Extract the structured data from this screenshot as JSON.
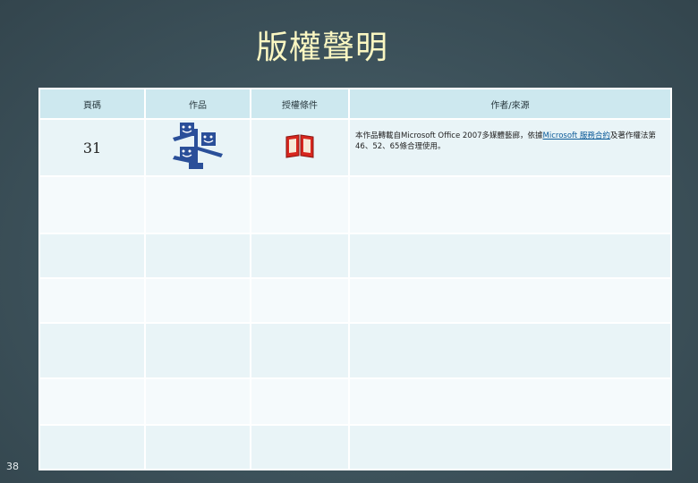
{
  "slide": {
    "title": "版權聲明",
    "number": "38"
  },
  "table": {
    "headers": [
      "頁碼",
      "作品",
      "授權條件",
      "作者/來源"
    ],
    "rows": [
      {
        "page": "31",
        "work_icon": "people-network-clipart-icon",
        "license_icon": "red-book-icon",
        "source_before": "本作品轉載自Microsoft Office 2007多媒體藝廊，依據",
        "source_link": "Microsoft 服務合約",
        "source_after": "及著作權法第46、52、65條合理使用。"
      }
    ],
    "empty_rows": 6
  },
  "colors": {
    "background": "#3d525b",
    "title": "#fbf7c2",
    "header_fill": "#cde8ef",
    "row_odd": "#e9f4f7",
    "row_even": "#f5fafc",
    "people_icon": "#2a4f99",
    "book_icon": "#d7261e"
  }
}
